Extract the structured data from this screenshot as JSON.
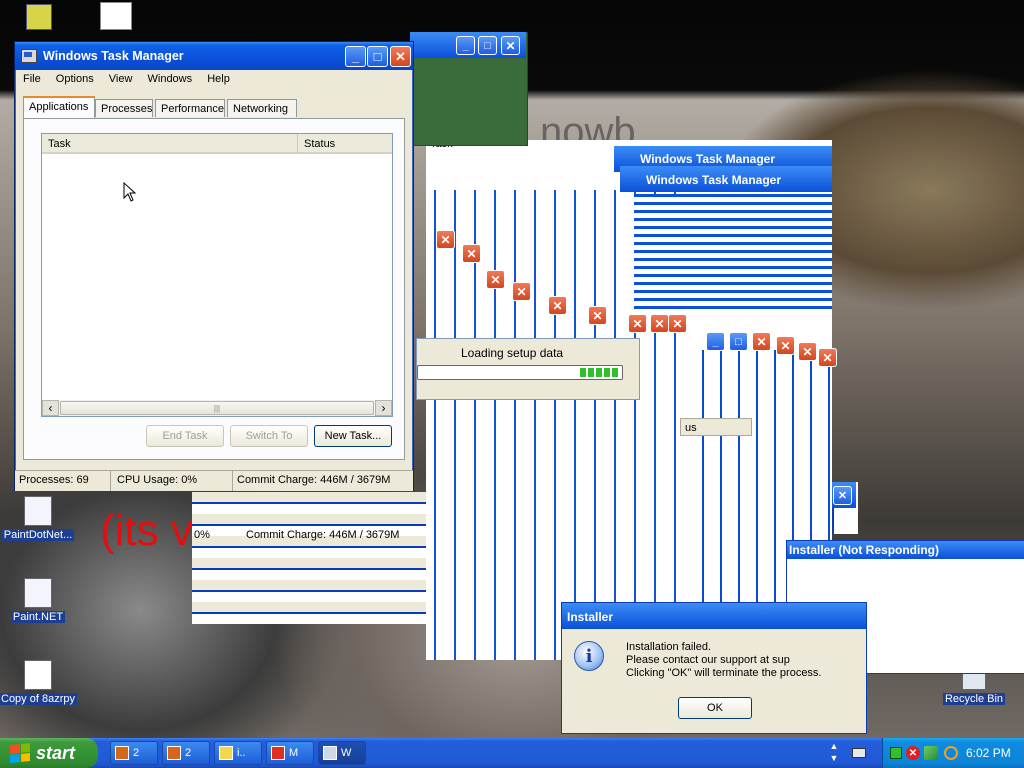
{
  "background_text": {
    "its": "(its v",
    "nowb": "nowb"
  },
  "desktop_icons": [
    {
      "label": "PaintDotNet..."
    },
    {
      "label": "Paint.NET"
    },
    {
      "label": "Copy of 8azrpy"
    },
    {
      "label": "Recycle Bin"
    }
  ],
  "task_manager": {
    "title": "Windows Task Manager",
    "menu": [
      "File",
      "Options",
      "View",
      "Windows",
      "Help"
    ],
    "tabs": [
      "Applications",
      "Processes",
      "Performance",
      "Networking"
    ],
    "active_tab": "Applications",
    "columns": [
      "Task",
      "Status"
    ],
    "buttons": {
      "end_task": "End Task",
      "switch_to": "Switch To",
      "new_task": "New Task..."
    },
    "status": {
      "processes": "Processes: 69",
      "cpu": "CPU Usage: 0%",
      "commit": "Commit Charge: 446M / 3679M"
    }
  },
  "ghost_windows": {
    "title": "Windows Task Manager",
    "column_task": "Task",
    "column_status": "us",
    "commit_echo": "Commit Charge: 446M / 3679M",
    "commit_pct": "0%"
  },
  "loading": {
    "text": "Loading setup data",
    "progress_blocks": 5
  },
  "installer_dialog": {
    "title": "Installer",
    "line1": "Installation failed.",
    "line2": "Please contact our support at sup",
    "line3": "Clicking \"OK\" will terminate the process.",
    "ok": "OK"
  },
  "installer_not_responding": {
    "title": "Installer (Not Responding)"
  },
  "taskbar": {
    "start": "start",
    "items": [
      {
        "label": "2",
        "icon_color": "#d6661e"
      },
      {
        "label": "2",
        "icon_color": "#d6661e"
      },
      {
        "label": "i..",
        "icon_color": "#f2d84a"
      },
      {
        "label": "M",
        "icon_color": "#e03020"
      },
      {
        "label": "W",
        "icon_color": "#cfd8e8"
      }
    ],
    "clock": "6:02 PM"
  },
  "icons": {
    "close": "✕",
    "minimize": "_",
    "maximize": "□",
    "info": "i",
    "scroll_left": "‹",
    "scroll_right": "›",
    "grip": "|||"
  },
  "colors": {
    "xp_blue": "#0a50d8",
    "close_red": "#d2461e",
    "start_green": "#2f8a2f",
    "progress_green": "#2fbf2f"
  }
}
